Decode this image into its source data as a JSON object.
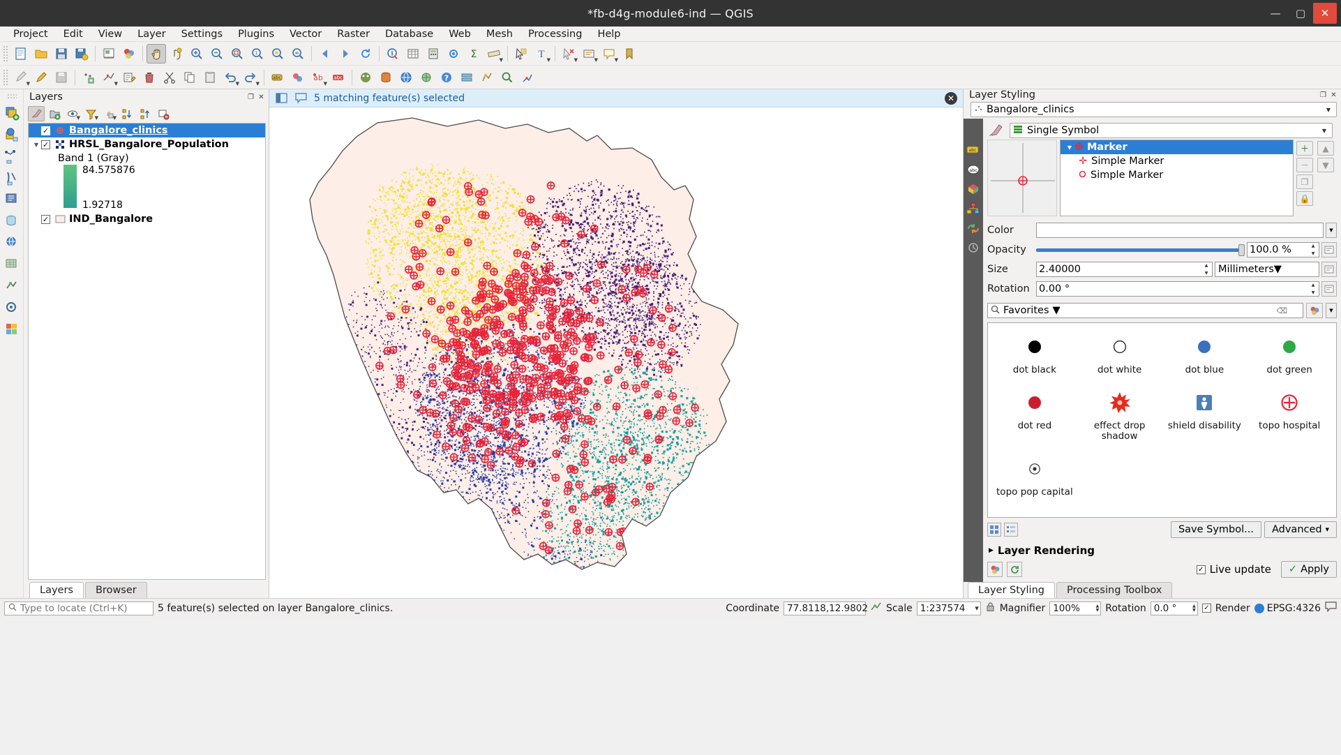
{
  "window": {
    "title": "*fb-d4g-module6-ind — QGIS",
    "minimize": "—",
    "maximize": "▢",
    "close": "✕"
  },
  "menubar": {
    "items": [
      "Project",
      "Edit",
      "View",
      "Layer",
      "Settings",
      "Plugins",
      "Vector",
      "Raster",
      "Database",
      "Web",
      "Mesh",
      "Processing",
      "Help"
    ]
  },
  "toolbar1": {
    "icons": [
      "new-project-icon",
      "open-project-icon",
      "save-project-icon",
      "save-project-as-icon",
      "print-layout-icon",
      "style-manager-icon",
      "pan-map-icon",
      "pan-to-selection-icon",
      "zoom-in-icon",
      "zoom-out-icon",
      "zoom-full-icon",
      "zoom-native-icon",
      "zoom-selection-icon",
      "zoom-layer-icon",
      "zoom-last-icon",
      "zoom-next-icon",
      "refresh-icon",
      "identify-features-icon",
      "open-attribute-table-icon",
      "open-field-calculator-icon",
      "processing-toolbox-icon",
      "statistical-summary-icon",
      "measure-line-icon",
      "select-features-icon",
      "text-annotation-icon",
      "deselect-features-icon",
      "select-value-icon",
      "map-tips-icon",
      "new-bookmark-icon",
      "show-bookmarks-icon"
    ]
  },
  "toolbar2": {
    "icons": [
      "current-edits-icon",
      "toggle-editing-icon",
      "save-layer-edits-icon",
      "add-feature-icon",
      "vertex-tool-icon",
      "modify-attributes-icon",
      "delete-selected-icon",
      "cut-features-icon",
      "copy-features-icon",
      "paste-features-icon",
      "undo-icon",
      "redo-icon",
      "label-icon",
      "layer-labeling-icon",
      "diagram-icon",
      "highlight-pinned-labels-icon",
      "pin-labels-icon",
      "show-hide-labels-icon",
      "plugin-python-icon",
      "db-manager-icon",
      "web-icon",
      "georeferencer-icon",
      "metasearch-icon",
      "help-contents-icon",
      "qgis-server-icon",
      "mesh-icon",
      "search-icon",
      "measure-icon"
    ]
  },
  "rail": {
    "icons": [
      "add-vector-layer-icon",
      "add-raster-layer-icon",
      "add-mesh-layer-icon",
      "add-delimited-text-icon",
      "add-postgis-layer-icon",
      "add-spatialite-layer-icon",
      "add-mssql-layer-icon",
      "add-oracle-layer-icon",
      "add-virtual-layer-icon",
      "add-wms-layer-icon",
      "add-wcs-layer-icon",
      "add-wfs-layer-icon",
      "add-arcgis-layer-icon",
      "add-vectortile-layer-icon"
    ]
  },
  "layers_panel": {
    "title": "Layers",
    "toolbar_icons": [
      "open-layer-styling-icon",
      "add-group-icon",
      "manage-layer-visibility-icon",
      "filter-legend-icon",
      "filter-legend-expression-icon",
      "expand-all-icon",
      "collapse-all-icon",
      "remove-layer-icon"
    ],
    "tree": [
      {
        "name": "Bangalore_clinics",
        "icon": "point-layer-icon",
        "checked": true,
        "selected": true,
        "expandable": false
      },
      {
        "name": "HRSL_Bangalore_Population",
        "icon": "raster-layer-icon",
        "checked": true,
        "selected": false,
        "expandable": true,
        "band_label": "Band 1 (Gray)",
        "ramp_max": "84.575876",
        "ramp_min": "1.92718",
        "ramp_top_color": "#5fc47e",
        "ramp_bottom_color": "#2f9e8f"
      },
      {
        "name": "IND_Bangalore",
        "icon": "polygon-layer-icon",
        "checked": true,
        "selected": false,
        "expandable": false,
        "swatch_color": "#fdeee7"
      }
    ],
    "tabs": [
      {
        "label": "Layers",
        "active": true
      },
      {
        "label": "Browser",
        "active": false
      }
    ]
  },
  "message_bar": {
    "icons": [
      "panel-toggle-icon",
      "message-bubble-icon"
    ],
    "text": "5 matching feature(s) selected",
    "close_icon": "close-icon"
  },
  "layer_styling": {
    "title": "Layer Styling",
    "dock_buttons": [
      "undock-icon",
      "close-icon"
    ],
    "layer_combo": {
      "value": "Bangalore_clinics",
      "icon": "point-layer-icon"
    },
    "renderer_combo": {
      "value": "Single Symbol",
      "icon": "single-symbol-icon"
    },
    "side_icons": [
      "symbology-icon",
      "labels-icon",
      "masks-icon",
      "3d-view-icon",
      "diagrams-icon",
      "actions-icon",
      "history-icon"
    ],
    "symbol_tree": [
      {
        "label": "Marker",
        "level": 0,
        "selected": true,
        "icon": "marker-icon"
      },
      {
        "label": "Simple Marker",
        "level": 1,
        "selected": false,
        "icon": "cross-marker-icon"
      },
      {
        "label": "Simple Marker",
        "level": 1,
        "selected": false,
        "icon": "circle-marker-icon"
      }
    ],
    "symbol_tree_buttons": [
      "add-symbol-layer-icon",
      "remove-symbol-layer-icon",
      "duplicate-symbol-layer-icon",
      "move-up-icon",
      "move-down-icon",
      "lock-icon"
    ],
    "fields": {
      "color_label": "Color",
      "color_value": "#ffffff",
      "opacity_label": "Opacity",
      "opacity_value": "100.0 %",
      "size_label": "Size",
      "size_value": "2.40000",
      "size_unit": "Millimeters",
      "rotation_label": "Rotation",
      "rotation_value": "0.00 °"
    },
    "search": {
      "value": "Favorites",
      "placeholder": "Favorites",
      "icon": "search-icon",
      "clear_icon": "clear-icon"
    },
    "symbol_library": [
      {
        "label": "dot black",
        "art": "dot",
        "color": "#000000"
      },
      {
        "label": "dot white",
        "art": "dot-outline",
        "color": "#ffffff"
      },
      {
        "label": "dot blue",
        "art": "dot",
        "color": "#3b6fbf"
      },
      {
        "label": "dot green",
        "art": "dot",
        "color": "#2fa84a"
      },
      {
        "label": "dot red",
        "art": "dot",
        "color": "#cc1f2e"
      },
      {
        "label": "effect drop shadow",
        "art": "starburst",
        "color": "#e8291c"
      },
      {
        "label": "shield disability",
        "art": "shield",
        "color": "#4a7fb5"
      },
      {
        "label": "topo hospital",
        "art": "hospital",
        "color": "#e8253a"
      },
      {
        "label": "topo pop capital",
        "art": "pop-capital",
        "color": "#333333"
      }
    ],
    "library_view_icons": [
      "icon-view-icon",
      "list-view-icon"
    ],
    "save_symbol_label": "Save Symbol...",
    "advanced_label": "Advanced",
    "layer_rendering_label": "Layer Rendering",
    "footer_icons": [
      "style-manager-icon",
      "refresh-style-icon"
    ],
    "live_update_label": "Live update",
    "live_update_checked": true,
    "apply_label": "Apply",
    "apply_icon": "check-icon",
    "tabs": [
      {
        "label": "Layer Styling",
        "active": true
      },
      {
        "label": "Processing Toolbox",
        "active": false
      }
    ]
  },
  "statusbar": {
    "locate_placeholder": "Type to locate (Ctrl+K)",
    "locate_icon": "search-icon",
    "message": "5 feature(s) selected on layer Bangalore_clinics.",
    "coordinate_label": "Coordinate",
    "coordinate_value": "77.8118,12.9802",
    "coordinate_toggle_icon": "toggle-extents-icon",
    "scale_label": "Scale",
    "scale_value": "1:237574",
    "lock_icon": "lock-scale-icon",
    "magnifier_label": "Magnifier",
    "magnifier_value": "100%",
    "rotation_label": "Rotation",
    "rotation_value": "0.0 °",
    "render_label": "Render",
    "render_checked": true,
    "crs_label": "EPSG:4326",
    "crs_icon": "crs-globe-icon",
    "messages_icon": "messages-icon"
  },
  "map": {
    "boundary_fill": "#fdeee7",
    "boundary_stroke": "#555555",
    "cluster_colors": {
      "yellow": "#f2e13c",
      "purple": "#4b1f78",
      "teal": "#199f9f",
      "blue": "#2b3fa8"
    },
    "marker_color": "#e8253a"
  }
}
